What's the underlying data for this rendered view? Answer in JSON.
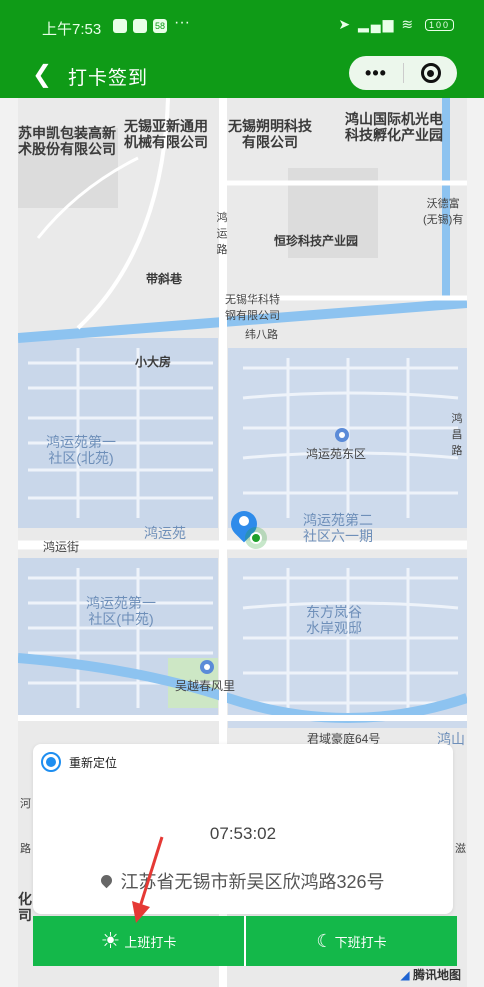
{
  "status_bar": {
    "time": "上午7:53",
    "badge": "58",
    "dots": "···",
    "signal_text": "4G",
    "battery": "100"
  },
  "nav": {
    "back_icon": "chevron-left-icon",
    "title": "打卡签到",
    "more_label": "•••",
    "close_icon": "target-close-icon",
    "bar_color": "#0f9b17"
  },
  "map": {
    "labels": {
      "company1": "苏申凯包装高新\n术股份有限公司",
      "company2": "无锡亚新通用\n机械有限公司",
      "company3": "无锡朔明科技\n有限公司",
      "company4": "鸿山国际机光电\n科技孵化产业园",
      "wode": "沃德富\n(无锡)有",
      "honglu": "鸿\n运\n路",
      "hengzhen": "恒珍科技产业园",
      "daixiang": "带斜巷",
      "huake": "无锡华科特\n钢有限公司",
      "weibalu": "纬八路",
      "xiaodafang": "小大房",
      "hongyuan_north": "鸿运苑第一\n社区(北苑)",
      "hongyuan_east": "鸿运苑东区",
      "hongchang": "鸿\n昌\n路",
      "hongyuan": "鸿运苑",
      "hongyuan_six": "鸿运苑第二\n社区六一期",
      "hongyunjie": "鸿运街",
      "hongyuan_mid": "鸿运苑第一\n社区(中苑)",
      "dongfang": "东方岚谷\n水岸观邸",
      "wuyue": "吴越春风里",
      "junyu": "君域豪庭64号",
      "hongshan": "鸿山",
      "he": "河",
      "lu": "路",
      "hua": "化\n司",
      "zhi": "滋"
    },
    "brand_logo": "tencent-map-logo",
    "brand_text": "腾讯地图"
  },
  "card": {
    "relocate_label": "重新定位",
    "time": "07:53:02",
    "address": "江苏省无锡市新吴区欣鸿路326号"
  },
  "buttons": {
    "check_in_label": "上班打卡",
    "check_out_label": "下班打卡",
    "color": "#14b84a"
  }
}
